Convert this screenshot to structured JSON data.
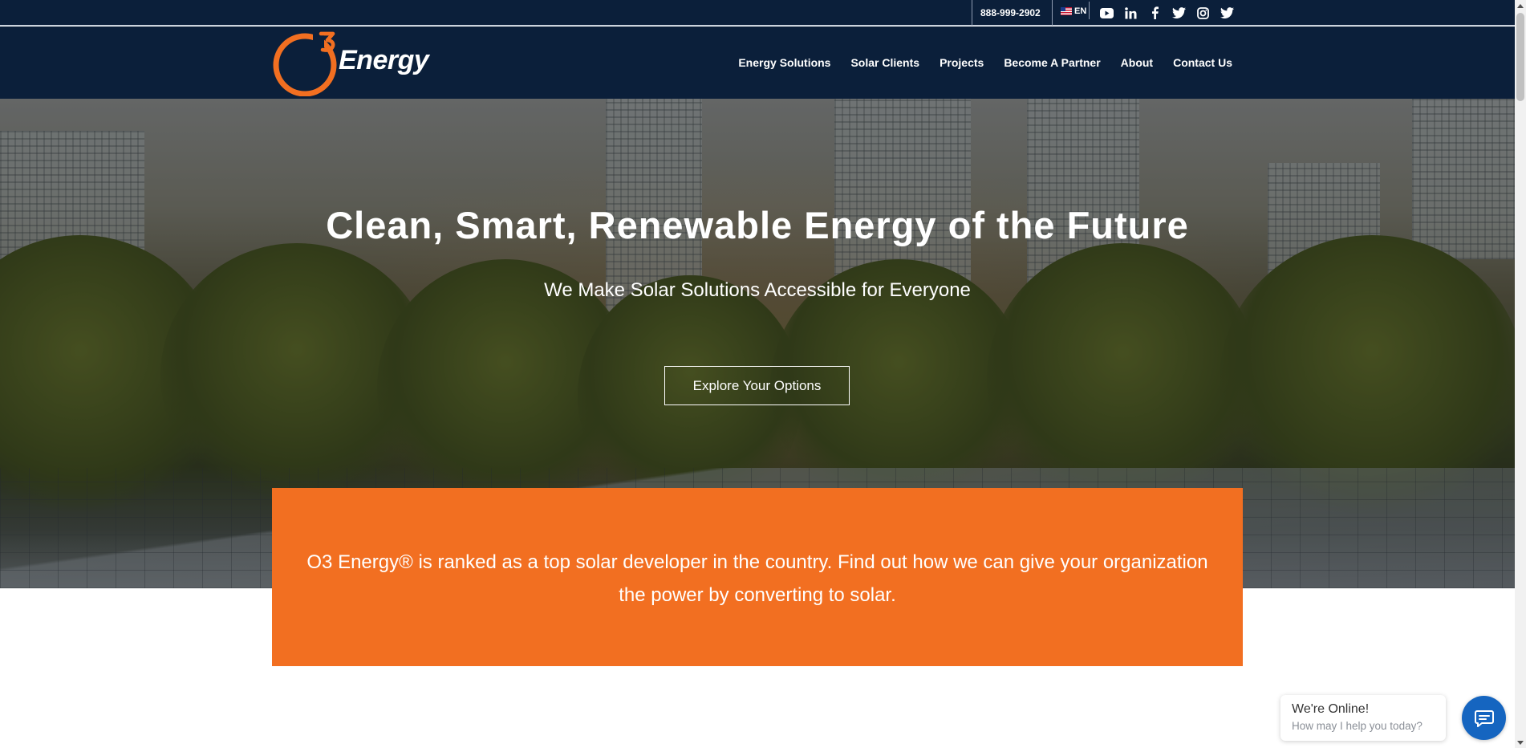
{
  "topbar": {
    "phone": "888-999-2902",
    "language": "EN",
    "social_icons": [
      "youtube-icon",
      "linkedin-icon",
      "facebook-icon",
      "twitter-icon",
      "instagram-icon",
      "twitter-icon"
    ]
  },
  "header": {
    "logo_text": "Energy",
    "nav": [
      "Energy Solutions",
      "Solar Clients",
      "Projects",
      "Become A Partner",
      "About",
      "Contact Us"
    ]
  },
  "hero": {
    "title": "Clean, Smart, Renewable Energy of the Future",
    "subtitle": "We Make Solar Solutions Accessible for Everyone",
    "cta": "Explore Your Options"
  },
  "band": {
    "text": "O3 Energy® is ranked as a top solar developer in the country. Find out how we can give your organization the power by converting to solar."
  },
  "chat": {
    "title": "We're Online!",
    "subtitle": "How may I help you today?"
  },
  "colors": {
    "navy": "#0b1f3a",
    "orange": "#f26f21",
    "chat_blue": "#1565c0"
  }
}
